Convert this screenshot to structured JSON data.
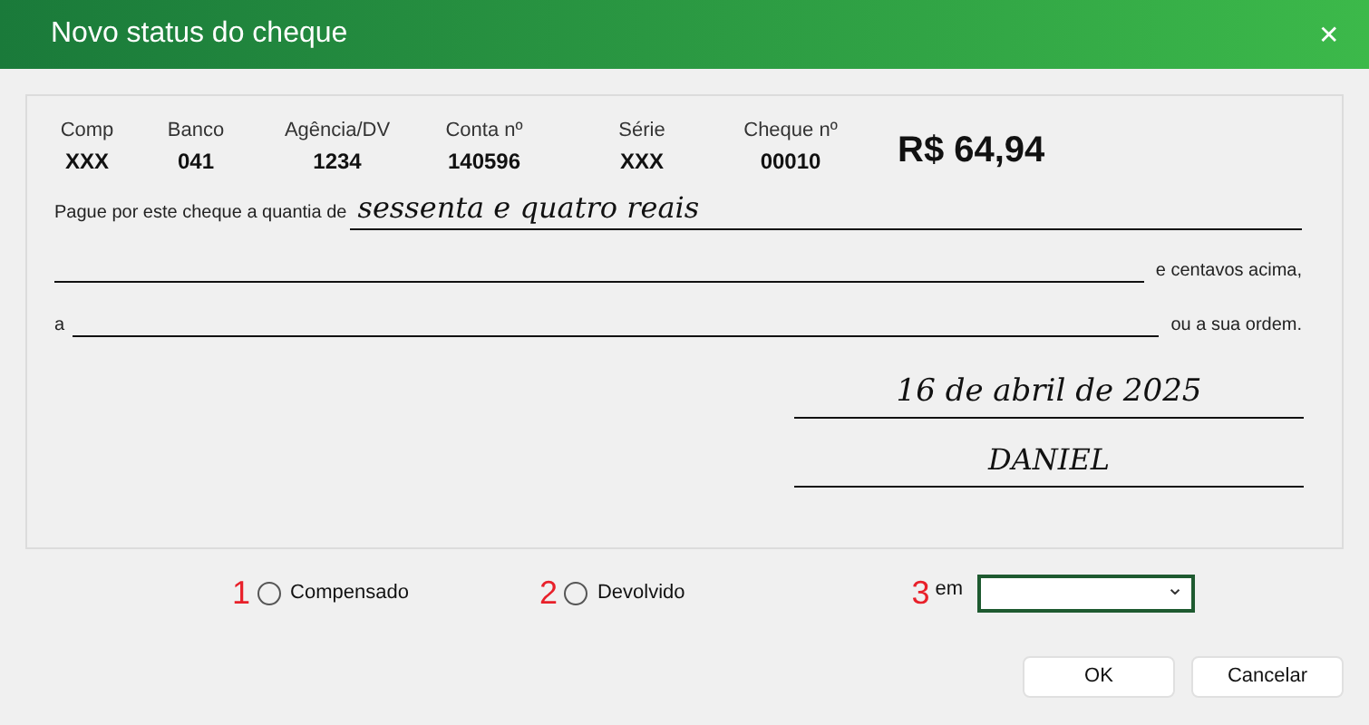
{
  "window": {
    "title": "Novo status do cheque",
    "close": "✕"
  },
  "check": {
    "fields": [
      {
        "label": "Comp",
        "value": "XXX"
      },
      {
        "label": "Banco",
        "value": "041"
      },
      {
        "label": "Agência/DV",
        "value": "1234"
      },
      {
        "label": "Conta nº",
        "value": "140596"
      },
      {
        "label": "Série",
        "value": "XXX"
      },
      {
        "label": "Cheque nº",
        "value": "00010"
      }
    ],
    "amount": "R$ 64,94",
    "pay_label": "Pague por este cheque a quantia de",
    "amount_words": "sessenta e quatro reais",
    "cents_label": "e centavos acima,",
    "to_label": "a",
    "order_label": "ou a sua ordem.",
    "date": "16 de abril de 2025",
    "signature": "DANIEL"
  },
  "status_options": [
    {
      "marker": "1",
      "label": "Compensado",
      "selected": false
    },
    {
      "marker": "2",
      "label": "Devolvido",
      "selected": false
    }
  ],
  "date_field": {
    "marker": "3",
    "label": "em",
    "caret": "⌄"
  },
  "buttons": [
    "OK",
    "Cancelar"
  ]
}
